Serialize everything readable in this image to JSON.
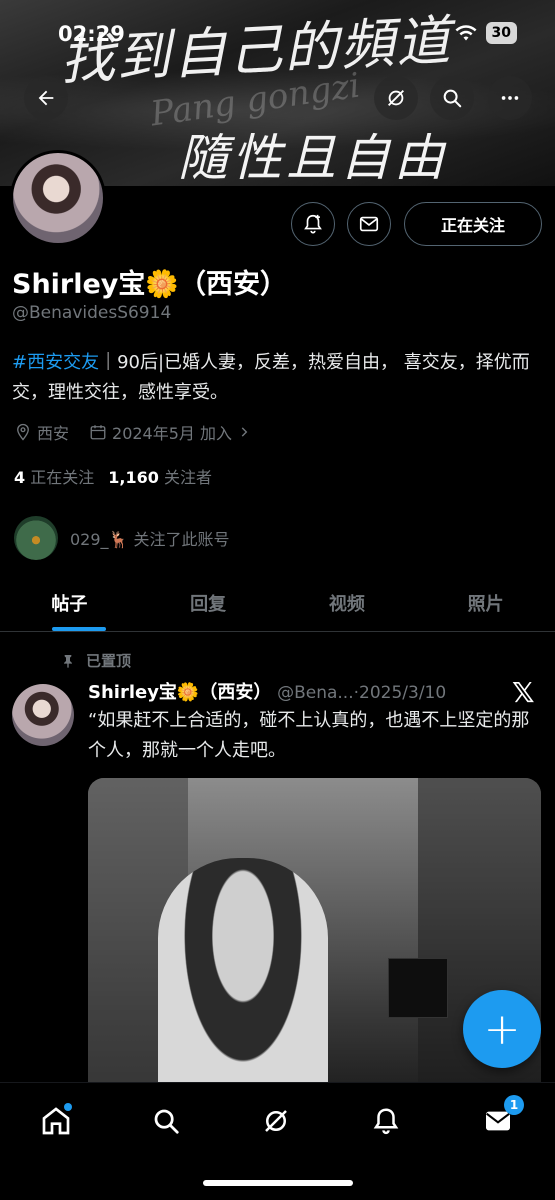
{
  "status_bar": {
    "time": "02:29",
    "battery": "30"
  },
  "banner": {
    "line1": "找到自己的頻道",
    "script": "Pang gongzi",
    "line2": "隨性且自由"
  },
  "profile": {
    "follow_button": "正在关注",
    "name": "Shirley宝🌼（西安）",
    "handle": "@BenavidesS6914",
    "bio_hashtag": "#西安交友",
    "bio_text": "｜90后|已婚人妻，反差，热爱自由， 喜交友，择优而交，理性交往，感性享受。",
    "location": "西安",
    "joined": "2024年5月 加入",
    "following_count": "4",
    "following_label": "正在关注",
    "followers_count": "1,160",
    "followers_label": "关注者",
    "followed_by_text": "029_🦌 关注了此账号"
  },
  "tabs": [
    {
      "label": "帖子"
    },
    {
      "label": "回复"
    },
    {
      "label": "视频"
    },
    {
      "label": "照片"
    }
  ],
  "pinned_post": {
    "pinned_label": "已置顶",
    "author_name": "Shirley宝🌼（西安）",
    "author_handle_date": "@Bena...·2025/3/10",
    "text": "“如果赶不上合适的，碰不上认真的，也遇不上坚定的那个人，那就一个人走吧。"
  },
  "fab": {
    "label": "+"
  },
  "bottom_nav": {
    "messages_badge": "1"
  },
  "colors": {
    "accent": "#1d9bf0",
    "muted": "#71767b",
    "background": "#000000"
  }
}
